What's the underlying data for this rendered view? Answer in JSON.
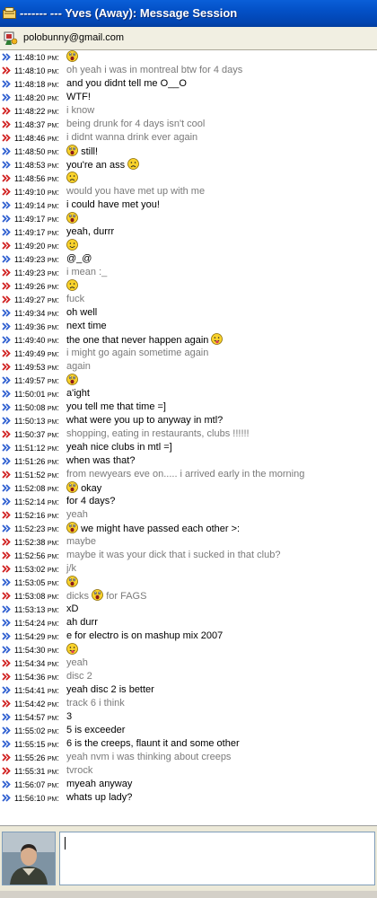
{
  "window": {
    "title": "------- --- Yves (Away): Message Session"
  },
  "contact": {
    "email": "polobunny@gmail.com"
  },
  "messages": [
    {
      "time": "11:48:10",
      "ampm": "PM",
      "from": "me",
      "text": "",
      "emoticons": [
        "shocked-emoticon"
      ]
    },
    {
      "time": "11:48:10",
      "ampm": "PM",
      "from": "them",
      "text": "oh yeah i was in montreal btw for 4 days",
      "emoticons": []
    },
    {
      "time": "11:48:18",
      "ampm": "PM",
      "from": "me",
      "text": "and you didnt tell me O__O",
      "emoticons": []
    },
    {
      "time": "11:48:20",
      "ampm": "PM",
      "from": "me",
      "text": "WTF!",
      "emoticons": []
    },
    {
      "time": "11:48:22",
      "ampm": "PM",
      "from": "them",
      "text": "i know",
      "emoticons": []
    },
    {
      "time": "11:48:37",
      "ampm": "PM",
      "from": "them",
      "text": "being drunk for 4 days isn't cool",
      "emoticons": []
    },
    {
      "time": "11:48:46",
      "ampm": "PM",
      "from": "them",
      "text": "i didnt wanna drink ever again",
      "emoticons": []
    },
    {
      "time": "11:48:50",
      "ampm": "PM",
      "from": "me",
      "text": "still!",
      "emoticons": [
        "shocked-emoticon"
      ],
      "emo_first": true
    },
    {
      "time": "11:48:53",
      "ampm": "PM",
      "from": "me",
      "text": "you're an ass",
      "emoticons": [
        "sad-emoticon"
      ]
    },
    {
      "time": "11:48:56",
      "ampm": "PM",
      "from": "them",
      "text": "",
      "emoticons": [
        "sad-emoticon"
      ]
    },
    {
      "time": "11:49:10",
      "ampm": "PM",
      "from": "them",
      "text": "would you have met up with me",
      "emoticons": []
    },
    {
      "time": "11:49:14",
      "ampm": "PM",
      "from": "me",
      "text": "i could have met you!",
      "emoticons": []
    },
    {
      "time": "11:49:17",
      "ampm": "PM",
      "from": "me",
      "text": "",
      "emoticons": [
        "shocked-emoticon"
      ]
    },
    {
      "time": "11:49:17",
      "ampm": "PM",
      "from": "me",
      "text": "yeah, durrr",
      "emoticons": []
    },
    {
      "time": "11:49:20",
      "ampm": "PM",
      "from": "them",
      "text": "",
      "emoticons": [
        "smile-emoticon"
      ]
    },
    {
      "time": "11:49:23",
      "ampm": "PM",
      "from": "me",
      "text": "@_@",
      "emoticons": []
    },
    {
      "time": "11:49:23",
      "ampm": "PM",
      "from": "them",
      "text": "i mean :_",
      "emoticons": []
    },
    {
      "time": "11:49:26",
      "ampm": "PM",
      "from": "them",
      "text": "",
      "emoticons": [
        "sad-emoticon"
      ]
    },
    {
      "time": "11:49:27",
      "ampm": "PM",
      "from": "them",
      "text": "fuck",
      "emoticons": []
    },
    {
      "time": "11:49:34",
      "ampm": "PM",
      "from": "me",
      "text": "oh well",
      "emoticons": []
    },
    {
      "time": "11:49:36",
      "ampm": "PM",
      "from": "me",
      "text": "next time",
      "emoticons": []
    },
    {
      "time": "11:49:40",
      "ampm": "PM",
      "from": "me",
      "text": "the one that never happen again",
      "emoticons": [
        "tongue-emoticon"
      ]
    },
    {
      "time": "11:49:49",
      "ampm": "PM",
      "from": "them",
      "text": "i might go again sometime again",
      "emoticons": []
    },
    {
      "time": "11:49:53",
      "ampm": "PM",
      "from": "them",
      "text": "again",
      "emoticons": []
    },
    {
      "time": "11:49:57",
      "ampm": "PM",
      "from": "me",
      "text": "",
      "emoticons": [
        "shocked-emoticon"
      ]
    },
    {
      "time": "11:50:01",
      "ampm": "PM",
      "from": "me",
      "text": "a'ight",
      "emoticons": []
    },
    {
      "time": "11:50:08",
      "ampm": "PM",
      "from": "me",
      "text": "you tell me that time =]",
      "emoticons": []
    },
    {
      "time": "11:50:13",
      "ampm": "PM",
      "from": "me",
      "text": "what were you up to anyway in mtl?",
      "emoticons": []
    },
    {
      "time": "11:50:37",
      "ampm": "PM",
      "from": "them",
      "text": "shopping, eating in restaurants, clubs !!!!!!",
      "emoticons": []
    },
    {
      "time": "11:51:12",
      "ampm": "PM",
      "from": "me",
      "text": "yeah nice clubs in mtl =]",
      "emoticons": []
    },
    {
      "time": "11:51:26",
      "ampm": "PM",
      "from": "me",
      "text": "when was that?",
      "emoticons": []
    },
    {
      "time": "11:51:52",
      "ampm": "PM",
      "from": "them",
      "text": "from newyears eve on..... i arrived early in the morning",
      "emoticons": []
    },
    {
      "time": "11:52:08",
      "ampm": "PM",
      "from": "me",
      "text": "okay",
      "emoticons": [
        "shocked-emoticon"
      ],
      "emo_first": true
    },
    {
      "time": "11:52:14",
      "ampm": "PM",
      "from": "me",
      "text": "for 4 days?",
      "emoticons": []
    },
    {
      "time": "11:52:16",
      "ampm": "PM",
      "from": "them",
      "text": "yeah",
      "emoticons": []
    },
    {
      "time": "11:52:23",
      "ampm": "PM",
      "from": "me",
      "text": "we might have passed each other >:",
      "emoticons": [
        "shocked-emoticon"
      ],
      "emo_first": true
    },
    {
      "time": "11:52:38",
      "ampm": "PM",
      "from": "them",
      "text": "maybe",
      "emoticons": []
    },
    {
      "time": "11:52:56",
      "ampm": "PM",
      "from": "them",
      "text": "maybe it was your dick that i sucked in that club?",
      "emoticons": []
    },
    {
      "time": "11:53:02",
      "ampm": "PM",
      "from": "them",
      "text": "j/k",
      "emoticons": []
    },
    {
      "time": "11:53:05",
      "ampm": "PM",
      "from": "me",
      "text": "",
      "emoticons": [
        "shocked-emoticon"
      ]
    },
    {
      "time": "11:53:08",
      "ampm": "PM",
      "from": "them",
      "text": "dicks",
      "emoticons": [
        "shocked-emoticon"
      ],
      "suffix": "for FAGS"
    },
    {
      "time": "11:53:13",
      "ampm": "PM",
      "from": "me",
      "text": "xD",
      "emoticons": []
    },
    {
      "time": "11:54:24",
      "ampm": "PM",
      "from": "me",
      "text": "ah durr",
      "emoticons": []
    },
    {
      "time": "11:54:29",
      "ampm": "PM",
      "from": "me",
      "text": "e for electro is on mashup mix 2007",
      "emoticons": []
    },
    {
      "time": "11:54:30",
      "ampm": "PM",
      "from": "me",
      "text": "",
      "emoticons": [
        "tongue-emoticon"
      ]
    },
    {
      "time": "11:54:34",
      "ampm": "PM",
      "from": "them",
      "text": "yeah",
      "emoticons": []
    },
    {
      "time": "11:54:36",
      "ampm": "PM",
      "from": "them",
      "text": "disc 2",
      "emoticons": []
    },
    {
      "time": "11:54:41",
      "ampm": "PM",
      "from": "me",
      "text": "yeah disc 2 is better",
      "emoticons": []
    },
    {
      "time": "11:54:42",
      "ampm": "PM",
      "from": "them",
      "text": "track 6 i think",
      "emoticons": []
    },
    {
      "time": "11:54:57",
      "ampm": "PM",
      "from": "me",
      "text": "3",
      "emoticons": []
    },
    {
      "time": "11:55:02",
      "ampm": "PM",
      "from": "me",
      "text": "5 is exceeder",
      "emoticons": []
    },
    {
      "time": "11:55:15",
      "ampm": "PM",
      "from": "me",
      "text": "6 is the creeps, flaunt it and some other",
      "emoticons": []
    },
    {
      "time": "11:55:26",
      "ampm": "PM",
      "from": "them",
      "text": "yeah nvm i was thinking about creeps",
      "emoticons": []
    },
    {
      "time": "11:55:31",
      "ampm": "PM",
      "from": "them",
      "text": "tvrock",
      "emoticons": []
    },
    {
      "time": "11:56:07",
      "ampm": "PM",
      "from": "me",
      "text": "myeah anyway",
      "emoticons": []
    },
    {
      "time": "11:56:10",
      "ampm": "PM",
      "from": "me",
      "text": "whats up lady?",
      "emoticons": []
    }
  ],
  "compose": {
    "value": ""
  },
  "colors": {
    "me_arrow": "#2E5FD0",
    "them_arrow": "#D02020",
    "them_text": "#7A7A7A",
    "title_bar": "#0A5FD8"
  }
}
